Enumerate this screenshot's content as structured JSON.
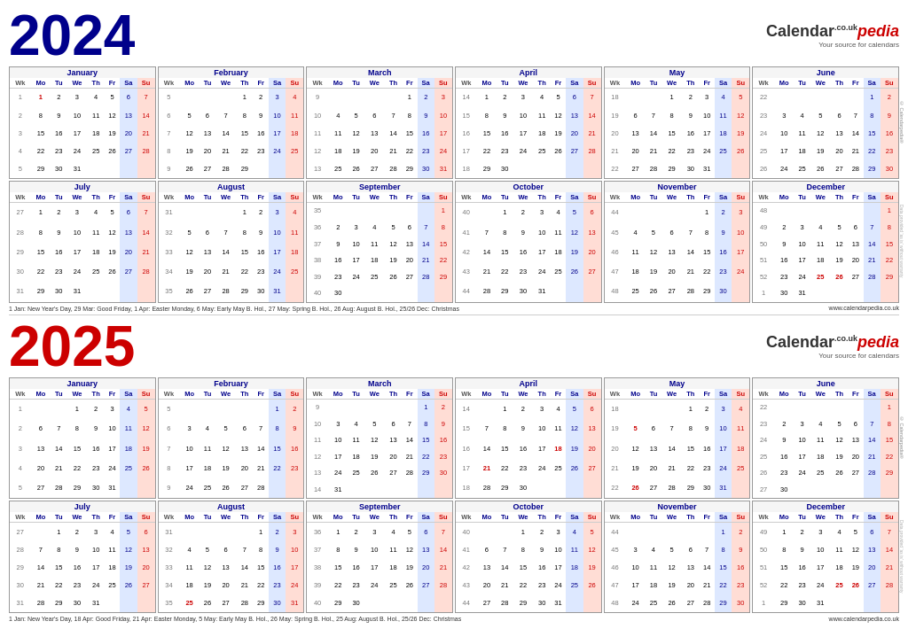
{
  "year2024": {
    "year": "2024",
    "brand": {
      "name_calendar": "Calendar",
      "name_pedia": "pedia",
      "couk": ".co.uk",
      "tagline": "Your source for calendars"
    },
    "footnote": "1 Jan: New Year's Day, 29 Mar: Good Friday, 1 Apr: Easter Monday, 6 May: Early May B. Hol., 27 May: Spring B. Hol., 26 Aug: August B. Hol., 25/26 Dec: Christmas",
    "website": "www.calendarpedia.co.uk",
    "months": [
      {
        "name": "January",
        "weeks": [
          [
            1,
            1,
            2,
            3,
            4,
            5,
            6,
            7
          ],
          [
            2,
            8,
            9,
            10,
            11,
            12,
            13,
            14
          ],
          [
            3,
            15,
            16,
            17,
            18,
            19,
            20,
            21
          ],
          [
            4,
            22,
            23,
            24,
            25,
            26,
            27,
            28
          ],
          [
            5,
            29,
            30,
            31,
            null,
            null,
            null,
            null
          ]
        ],
        "red_days": [
          1,
          7,
          14,
          21,
          28
        ],
        "blue_days": [
          6,
          13,
          20,
          27
        ]
      },
      {
        "name": "February",
        "weeks": [
          [
            5,
            null,
            null,
            null,
            1,
            2,
            3,
            4
          ],
          [
            6,
            5,
            6,
            7,
            8,
            9,
            10,
            11
          ],
          [
            7,
            12,
            13,
            14,
            15,
            16,
            17,
            18
          ],
          [
            8,
            19,
            20,
            21,
            22,
            23,
            24,
            25
          ],
          [
            9,
            26,
            27,
            28,
            29,
            null,
            null,
            null
          ]
        ]
      },
      {
        "name": "March",
        "weeks": [
          [
            9,
            null,
            null,
            null,
            null,
            1,
            2,
            3
          ],
          [
            10,
            4,
            5,
            6,
            7,
            8,
            9,
            10
          ],
          [
            11,
            11,
            12,
            13,
            14,
            15,
            16,
            17
          ],
          [
            12,
            18,
            19,
            20,
            21,
            22,
            23,
            24
          ],
          [
            13,
            25,
            26,
            27,
            28,
            29,
            30,
            31
          ]
        ]
      },
      {
        "name": "April",
        "weeks": [
          [
            14,
            1,
            2,
            3,
            4,
            5,
            6,
            7
          ],
          [
            15,
            8,
            9,
            10,
            11,
            12,
            13,
            14
          ],
          [
            16,
            15,
            16,
            17,
            18,
            19,
            20,
            21
          ],
          [
            17,
            22,
            23,
            24,
            25,
            26,
            27,
            28
          ],
          [
            18,
            29,
            30,
            null,
            null,
            null,
            null,
            null
          ]
        ]
      },
      {
        "name": "May",
        "weeks": [
          [
            18,
            null,
            null,
            1,
            2,
            3,
            4,
            5
          ],
          [
            19,
            6,
            7,
            8,
            9,
            10,
            11,
            12
          ],
          [
            20,
            13,
            14,
            15,
            16,
            17,
            18,
            19
          ],
          [
            21,
            20,
            21,
            22,
            23,
            24,
            25,
            26
          ],
          [
            22,
            27,
            28,
            29,
            30,
            31,
            null,
            null
          ]
        ]
      },
      {
        "name": "June",
        "weeks": [
          [
            22,
            null,
            null,
            null,
            null,
            null,
            1,
            2
          ],
          [
            23,
            3,
            4,
            5,
            6,
            7,
            8,
            9
          ],
          [
            24,
            10,
            11,
            12,
            13,
            14,
            15,
            16
          ],
          [
            25,
            17,
            18,
            19,
            20,
            21,
            22,
            23
          ],
          [
            26,
            24,
            25,
            26,
            27,
            28,
            29,
            30
          ]
        ]
      },
      {
        "name": "July",
        "weeks": [
          [
            27,
            1,
            2,
            3,
            4,
            5,
            6,
            7
          ],
          [
            28,
            8,
            9,
            10,
            11,
            12,
            13,
            14
          ],
          [
            29,
            15,
            16,
            17,
            18,
            19,
            20,
            21
          ],
          [
            30,
            22,
            23,
            24,
            25,
            26,
            27,
            28
          ],
          [
            31,
            29,
            30,
            31,
            null,
            null,
            null,
            null
          ]
        ]
      },
      {
        "name": "August",
        "weeks": [
          [
            31,
            null,
            null,
            null,
            1,
            2,
            3,
            4
          ],
          [
            32,
            5,
            6,
            7,
            8,
            9,
            10,
            11
          ],
          [
            33,
            12,
            13,
            14,
            15,
            16,
            17,
            18
          ],
          [
            34,
            19,
            20,
            21,
            22,
            23,
            24,
            25
          ],
          [
            35,
            26,
            27,
            28,
            29,
            30,
            31,
            null
          ]
        ]
      },
      {
        "name": "September",
        "weeks": [
          [
            35,
            null,
            null,
            null,
            null,
            null,
            null,
            1
          ],
          [
            36,
            2,
            3,
            4,
            5,
            6,
            7,
            8
          ],
          [
            37,
            9,
            10,
            11,
            12,
            13,
            14,
            15
          ],
          [
            38,
            16,
            17,
            18,
            19,
            20,
            21,
            22
          ],
          [
            39,
            23,
            24,
            25,
            26,
            27,
            28,
            29
          ],
          [
            40,
            30,
            null,
            null,
            null,
            null,
            null,
            null
          ]
        ]
      },
      {
        "name": "October",
        "weeks": [
          [
            40,
            null,
            1,
            2,
            3,
            4,
            5,
            6
          ],
          [
            41,
            7,
            8,
            9,
            10,
            11,
            12,
            13
          ],
          [
            42,
            14,
            15,
            16,
            17,
            18,
            19,
            20
          ],
          [
            43,
            21,
            22,
            23,
            24,
            25,
            26,
            27
          ],
          [
            44,
            28,
            29,
            30,
            31,
            null,
            null,
            null
          ]
        ]
      },
      {
        "name": "November",
        "weeks": [
          [
            44,
            null,
            null,
            null,
            null,
            1,
            2,
            3
          ],
          [
            45,
            4,
            5,
            6,
            7,
            8,
            9,
            10
          ],
          [
            46,
            11,
            12,
            13,
            14,
            15,
            16,
            17
          ],
          [
            47,
            18,
            19,
            20,
            21,
            22,
            23,
            24
          ],
          [
            48,
            25,
            26,
            27,
            28,
            29,
            30,
            null
          ]
        ]
      },
      {
        "name": "December",
        "weeks": [
          [
            48,
            null,
            null,
            null,
            null,
            null,
            null,
            1
          ],
          [
            49,
            2,
            3,
            4,
            5,
            6,
            7,
            8
          ],
          [
            50,
            9,
            10,
            11,
            12,
            13,
            14,
            15
          ],
          [
            51,
            16,
            17,
            18,
            19,
            20,
            21,
            22
          ],
          [
            52,
            23,
            24,
            25,
            26,
            27,
            28,
            29
          ],
          [
            1,
            30,
            31,
            null,
            null,
            null,
            null,
            null
          ]
        ]
      }
    ]
  },
  "year2025": {
    "year": "2025",
    "footnote": "1 Jan: New Year's Day, 18 Apr: Good Friday, 21 Apr: Easter Monday, 5 May: Early May B. Hol., 26 May: Spring B. Hol., 25 Aug: August B. Hol., 25/26 Dec: Christmas",
    "website": "www.calendarpedia.co.uk"
  }
}
